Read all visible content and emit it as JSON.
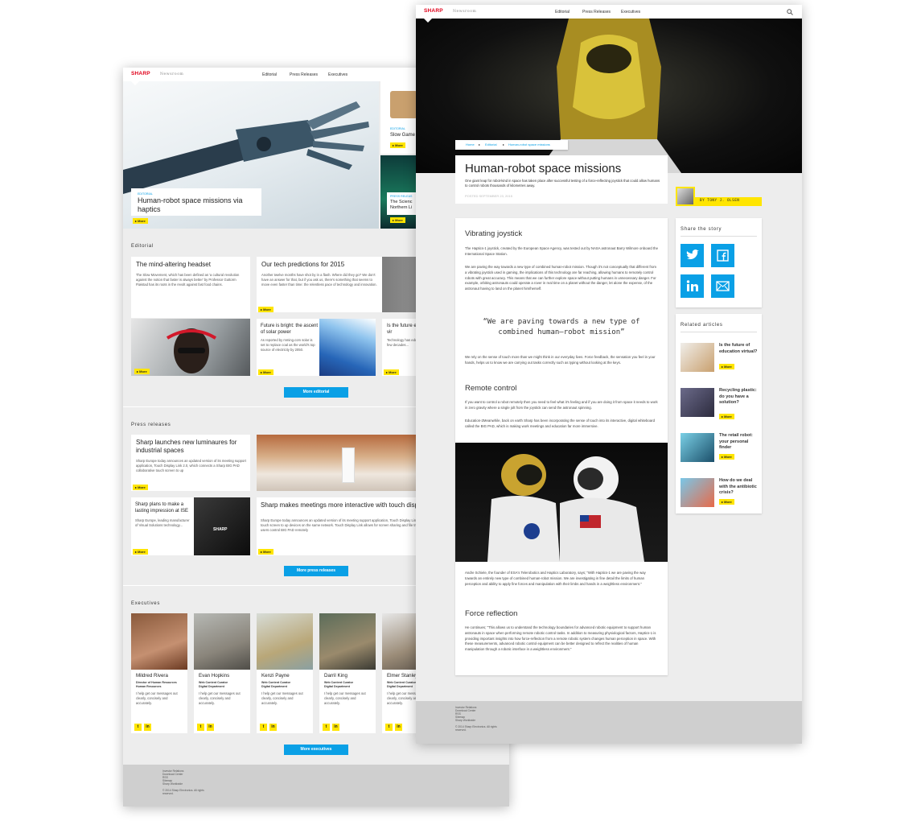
{
  "brand": {
    "logo": "SHARP",
    "product": "Newsroom"
  },
  "nav": {
    "editorial": "Editorial",
    "press": "Press Releases",
    "executives": "Executives"
  },
  "more": "▸ More",
  "back": {
    "hero": {
      "tag": "EDITORIAL",
      "title": "Human-robot space missions via haptics"
    },
    "side1": {
      "tag": "EDITORIAL",
      "title": "Slow Game"
    },
    "side2": {
      "tag": "PRESS RELEAS",
      "title1": "The Scienc",
      "title2": "Northern Li"
    },
    "editorial": {
      "heading": "Editorial",
      "c1": {
        "title": "The mind-altering headset",
        "text": "The Slow Movement, which has been defined as 'a cultural revolution against the notion that faster is always better' by Professor Guttorm Fløistad has its roots in the revolt against fast food chains."
      },
      "c2": {
        "title": "Our tech predictions for 2015",
        "text": "Another twelve months have shot by in a flash. Where did they go? We don't have an answer for that, but if you ask us, there's something that seems to move even faster than time: the relentless pace of technology and innovation."
      },
      "c3": {
        "title": "Future is bright: the ascent of solar power",
        "text": "As reported by mming.com solar is set to replace coal as the world's top source of electricity by 2050."
      },
      "c4": {
        "title": "Is the future education vir",
        "text": "Technology has education rapid few decades..."
      },
      "button": "More editorial"
    },
    "press": {
      "heading": "Press releases",
      "p1": {
        "title": "Sharp launches new luminaures for industrial spaces",
        "text": "Sharp Europe today announces an updated version of its meeting support application, Touch Display Link 2.0, which connects a Sharp BIG PAD collaborative touch screen to up"
      },
      "p2": {
        "title": "Sharp plans to make a lasting impression at ISE",
        "text": "Sharp Europe, leading manufacturer of Visual Solutions technology...",
        "screen": "SHARP"
      },
      "p3": {
        "title": "Sharp makes meetings more interactive with touch display Link 2.0 and Big Pad",
        "text": "Sharp Europe today announces an updated version of its meeting support application, Touch Display Link 2.0, which connects a Sharp BIG PAD collaborative touch screen to up devices on the same network. Touch Display Link allows for screen sharing and file tra between BIG PAD, tablets and smart phones, and lets users control BIG PAD remotely"
      },
      "button": "More press releases"
    },
    "execs": {
      "heading": "Executives",
      "desc": "I help get our messages out clearly, concisely and accurately.",
      "people": [
        {
          "name": "Mildred Rivera",
          "role1": "Director of Human Resources",
          "role2": "Human Resources"
        },
        {
          "name": "Evan Hopkins",
          "role1": "Web Content Curator",
          "role2": "Digital Department"
        },
        {
          "name": "Kenzi Payne",
          "role1": "Web Content Curator",
          "role2": "Digital Department"
        },
        {
          "name": "Darril King",
          "role1": "Web Content Curator",
          "role2": "Digital Department"
        },
        {
          "name": "Elmer Stanley",
          "role1": "Web Content Curator",
          "role2": "Digital Department"
        }
      ],
      "button": "More executives"
    }
  },
  "footer": {
    "l1": "Investor Relations",
    "l2": "Download Center",
    "l3": "RSS",
    "l4": "Sitemap",
    "l5": "Sharp Worldwide",
    "copy1": "© 2014 Sharp Electronics. All rights",
    "copy2": "reserved."
  },
  "article": {
    "crumbs": {
      "home": "Home",
      "section": "Editorial",
      "current": "Human-robot space missions"
    },
    "title": "Human-robot space missions",
    "lede": "One giant leap for robot-kind in space has taken place after successful testing of a force-reflecting joystick that could allow humans to control robots thousands of kilometres away.",
    "date": "POSTED SEPTEMBER 23, 2015",
    "author": "BY TONY J. OLSEN",
    "h1": "Vibrating joystick",
    "p1": "The Haptics-1 joystick, created by the European Space Agency, was tested out by NASA astronaut Barry Wilmore onboard the International Space Station.",
    "p2": "We are paving the way towards a new type of combined human-robot mission. Though it's not conceptually that different from a vibrating joystick used in gaming, the implications of this technology are far reaching, allowing humans to remotely control robots with great accuracy. This means that we can further explore space without putting humans in unnecessary danger. For example, orbiting astronauts could operate a rover in real time on a planet without the danger, let alone the expense, of the astronaut having to land on the planet him/herself.",
    "quote1": "“We are paving towards a new type of",
    "quote2": "combined human–robot mission”",
    "p3": "We rely on the sense of touch more than we might think in our everyday lives. Force feedback, the sensation you feel in your hands, helps us to know we are carrying out tasks correctly such as typing without looking at the keys.",
    "h2": "Remote control",
    "p4": "If you want to control a robot remotely then you need to feel what it's feeling and if you are doing it from space it needs to work in zero gravity where a single jolt from the joystick can send the astronaut spinning.",
    "p5": "Education-2Meanwhile, back on earth Sharp has been incorporating the sense of touch into its interactive, digital whiteboard called the BIG PAD, which is making work meetings and education far more immersive.",
    "p6": "Andre Schiele, the founder of ESA's Telerobotics and Haptics Laboratory, says; \"With Haptics-1 we are paving the way towards an entirely new type of combined human-robot mission. We are investigating in fine detail the limits of human perception and ability to apply fine forces and manipulation with their limbs and hands in a weightless environment.\"",
    "h3": "Force reflection",
    "p7": "He continues; \"This allows us to understand the technology boundaries for advanced robotic equipment to support human astronauts in space when performing remote robotic control tasks. In addition to measuring physiological factors, Haptics-1 is providing important insights into how force-reflection from a remote robotic system changes human perception in space. With these measurements, advanced robotic control equipment can be better designed to reflect the realities of human manipulation through a robotic interface in a weightless environment.\""
  },
  "share": {
    "heading": "Share the story"
  },
  "related": {
    "heading": "Related articles",
    "items": [
      {
        "title": "Is the future of education virtual?"
      },
      {
        "title": "Recycling plastic: do you have a solution?"
      },
      {
        "title": "The retail robot: your personal finder"
      },
      {
        "title": "How do we deal with the antibiotic crisis?"
      }
    ]
  },
  "colors": {
    "accent": "#0aa0e6",
    "highlight": "#ffe500",
    "brand": "#e0001a"
  }
}
